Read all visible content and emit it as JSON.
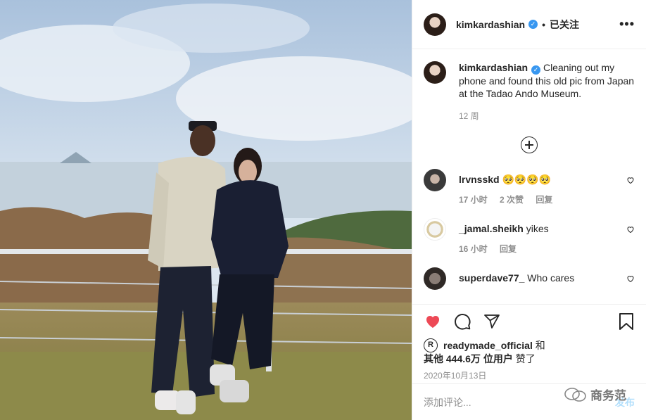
{
  "post": {
    "username": "kimkardashian",
    "follow_label": "已关注",
    "separator": "•",
    "more_label": "•••"
  },
  "caption": {
    "username": "kimkardashian",
    "text": "Cleaning out my phone and found this old pic from Japan at the Tadao Ando Museum.",
    "age": "12 周"
  },
  "comments": [
    {
      "username": "lrvnsskd",
      "text": "🥺🥺🥺🥺",
      "age": "17 小时",
      "likes": "2 次赞",
      "reply": "回复"
    },
    {
      "username": "_jamal.sheikh",
      "text": "yikes",
      "age": "16 小时",
      "reply": "回复"
    },
    {
      "username": "superdave77_",
      "text": "Who cares"
    }
  ],
  "likes": {
    "avatar_letter": "R",
    "first_user": "readymade_official",
    "and": "和",
    "others": "其他 444.6万 位用户",
    "liked": "赞了"
  },
  "date": "2020年10月13日",
  "add_comment": {
    "placeholder": "添加评论...",
    "post_label": "发布"
  },
  "watermark": {
    "text": "商务范"
  },
  "colors": {
    "like_red": "#ed4956",
    "verified_blue": "#3897f0",
    "post_disabled": "#b2dffc"
  }
}
